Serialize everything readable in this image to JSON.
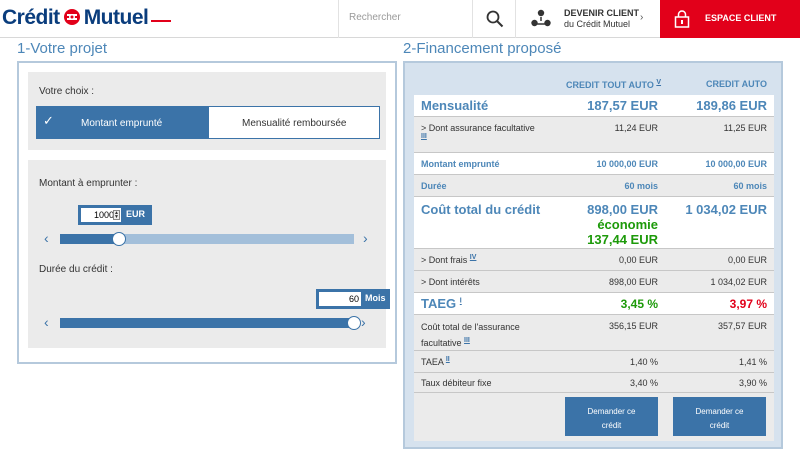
{
  "header": {
    "logo_text_1": "Crédit",
    "logo_text_2": "Mutuel",
    "search_placeholder": "Rechercher",
    "devenir_line1": "DEVENIR CLIENT",
    "devenir_line2": "du Crédit Mutuel",
    "espace_label": "ESPACE CLIENT",
    "brand_color": "#e2001a",
    "icons": [
      "search-icon",
      "people-icon",
      "chevron-right-icon",
      "lock-icon"
    ]
  },
  "project": {
    "title": "1-Votre projet",
    "choice_label": "Votre choix :",
    "options": [
      "Montant emprunté",
      "Mensualité remboursée"
    ],
    "selected": "Montant emprunté",
    "amount_label": "Montant à emprunter :",
    "amount_value": "10000",
    "amount_unit": "EUR",
    "amount_level": 0.2,
    "duration_label": "Durée du crédit :",
    "duration_value": "60",
    "duration_unit": "Mois",
    "duration_level": 1.0
  },
  "financing": {
    "title": "2-Financement proposé",
    "col1": "CREDIT TOUT AUTO",
    "col1_sup": "V",
    "col2": "CREDIT AUTO",
    "rows": {
      "mensualite": {
        "label": "Mensualité",
        "v1": "187,57 EUR",
        "v2": "189,86 EUR"
      },
      "assurance": {
        "label": "> Dont assurance facultative",
        "sup": "III",
        "v1": "11,24 EUR",
        "v2": "11,25 EUR"
      },
      "montant": {
        "label": "Montant emprunté",
        "v1": "10 000,00 EUR",
        "v2": "10 000,00 EUR"
      },
      "duree": {
        "label": "Durée",
        "v1": "60 mois",
        "v2": "60 mois"
      },
      "cout": {
        "label": "Coût total du crédit",
        "v1": "898,00 EUR",
        "economie_label": "économie",
        "economie_value": "137,44 EUR",
        "v2": "1 034,02 EUR"
      },
      "frais": {
        "label": "> Dont frais",
        "sup": "IV",
        "v1": "0,00 EUR",
        "v2": "0,00 EUR"
      },
      "interets": {
        "label": "> Dont intérêts",
        "v1": "898,00 EUR",
        "v2": "1 034,02 EUR"
      },
      "taeg": {
        "label": "TAEG",
        "sup": "I",
        "v1": "3,45 %",
        "v2": "3,97 %"
      },
      "cout_assurance": {
        "label_1": "Coût total de l'assurance",
        "label_2": "facultative",
        "sup": "III",
        "v1": "356,15 EUR",
        "v2": "357,57 EUR"
      },
      "taea": {
        "label": "TAEA",
        "sup": "II",
        "v1": "1,40 %",
        "v2": "1,41 %"
      },
      "taux": {
        "label": "Taux débiteur fixe",
        "v1": "3,40 %",
        "v2": "3,90 %"
      }
    },
    "button_line1": "Demander ce",
    "button_line2": "crédit"
  }
}
